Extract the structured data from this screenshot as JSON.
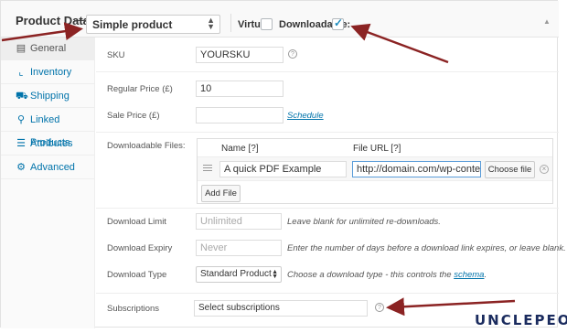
{
  "header": {
    "title": "Product Data",
    "dash": "—",
    "product_type": "Simple product",
    "virtual_label": "Virtual:",
    "downloadable_label": "Downloadable:"
  },
  "sidebar": {
    "items": [
      {
        "label": "General",
        "icon": "gear-icon"
      },
      {
        "label": "Inventory",
        "icon": "chart-icon"
      },
      {
        "label": "Shipping",
        "icon": "truck-icon"
      },
      {
        "label": "Linked Products",
        "icon": "link-icon"
      },
      {
        "label": "Attributes",
        "icon": "list-icon"
      },
      {
        "label": "Advanced",
        "icon": "cog-icon"
      }
    ]
  },
  "general": {
    "sku_label": "SKU",
    "sku_value": "YOURSKU",
    "regular_price_label": "Regular Price (£)",
    "regular_price_value": "10",
    "sale_price_label": "Sale Price (£)",
    "sale_price_value": "",
    "schedule_link": "Schedule",
    "downloadable_files_label": "Downloadable Files:",
    "files_table": {
      "col_name": "Name [?]",
      "col_url": "File URL [?]",
      "rows": [
        {
          "name": "A quick PDF Example",
          "url": "http://domain.com/wp-content/"
        }
      ],
      "choose_file": "Choose file",
      "add_file": "Add File"
    },
    "download_limit_label": "Download Limit",
    "download_limit_placeholder": "Unlimited",
    "download_limit_desc": "Leave blank for unlimited re-downloads.",
    "download_expiry_label": "Download Expiry",
    "download_expiry_placeholder": "Never",
    "download_expiry_desc": "Enter the number of days before a download link expires, or leave blank.",
    "download_type_label": "Download Type",
    "download_type_value": "Standard Product",
    "download_type_desc_pre": "Choose a download type - this controls the",
    "download_type_desc_link": "schema",
    "download_type_desc_post": ".",
    "subscriptions_label": "Subscriptions",
    "subscriptions_placeholder": "Select subscriptions",
    "help_glyph": "?"
  },
  "brand": "UNCLEPEOL",
  "colors": {
    "accent": "#0073aa",
    "arrow": "#8b2323",
    "brand": "#1a2b5e"
  }
}
